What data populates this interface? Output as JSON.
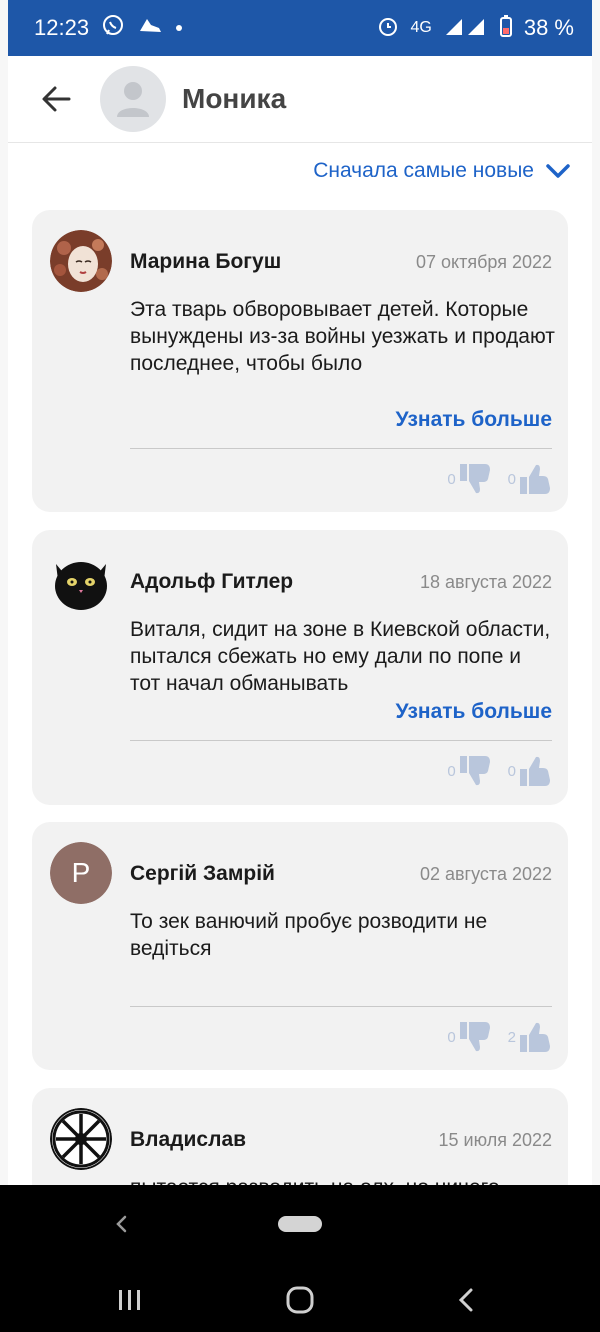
{
  "status_bar": {
    "time": "12:23",
    "network": "4G",
    "battery": "38 %"
  },
  "header": {
    "title": "Моника"
  },
  "sort": {
    "label": "Сначала самые новые"
  },
  "reviews": [
    {
      "author": "Марина Богуш",
      "date": "07 октября 2022",
      "text": "Эта тварь обворовывает детей. Которые вынуждены из-за войны уезжать и продают последнее, чтобы было",
      "more_label": "Узнать больше",
      "dislikes": "0",
      "likes": "0"
    },
    {
      "author": "Адольф Гитлер",
      "date": "18 августа 2022",
      "text": "Виталя, сидит на зоне в Киевской области, пытался сбежать но ему дали по попе и тот начал обманывать",
      "more_label": "Узнать больше",
      "dislikes": "0",
      "likes": "0"
    },
    {
      "author": "Сергій Замрій",
      "avatar_letter": "P",
      "date": "02 августа 2022",
      "text": "То зек ванючий пробує розводити не ведіться",
      "dislikes": "0",
      "likes": "2"
    },
    {
      "author": "Владислав",
      "date": "15 июля 2022",
      "text": "пытается разводить на олх, но ничего"
    }
  ],
  "colors": {
    "status_bar": "#1e57a8",
    "accent": "#1e63c8",
    "card_bg": "#f2f2f2",
    "vote_icon": "#b9c6dc"
  }
}
